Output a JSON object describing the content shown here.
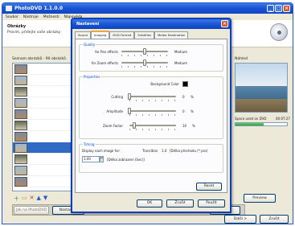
{
  "window": {
    "title": "PhotoDVD 1.1.0.0"
  },
  "menu": [
    "Soubor",
    "Nástroje",
    "Možnosti",
    "Nápověda"
  ],
  "header": {
    "title": "Obrázky",
    "subtitle": "Prosím, přidejte vaše obrázky"
  },
  "file_list": {
    "label": "Seznam obrázků - 90 obrázků",
    "rows": 11
  },
  "preview": {
    "label": "Náhled",
    "space_label": "Space used on DVD",
    "space_value": "00:07:27",
    "space_fraction": 0.55
  },
  "bottom_buttons": {
    "settings": "Nastavení",
    "back": "Zpět",
    "next": "Další >",
    "cancel": "Zrušit",
    "preview": "Preview",
    "left_hint": "Jak na PhotoDVD"
  },
  "dialog": {
    "title": "Nastavení",
    "tabs": [
      "Sound",
      "Imaging",
      "DVD Format",
      "Subtitles",
      "Media Destination"
    ],
    "active_tab": 1,
    "quality": {
      "label": "Quality",
      "pan_label": "for Pan effects",
      "pan_value": "Medium",
      "pan_level": 0.5,
      "zoom_label": "for Zoom effects",
      "zoom_value": "Medium",
      "zoom_level": 0.5
    },
    "properties": {
      "label": "Properties",
      "bg_label": "Background Color",
      "bg_color": "#000000",
      "cutting_label": "Cutting",
      "cutting_value": "0",
      "cutting_level": 0.0,
      "amplitude_label": "Amplitude",
      "amplitude_value": "0",
      "amplitude_level": 0.0,
      "zoom_factor_label": "Zoom Factor",
      "zoom_factor_value": "10",
      "zoom_factor_level": 0.1,
      "percent": "%"
    },
    "timing": {
      "label": "Timing",
      "display_label": "Display each image for:",
      "transition_label": "Transition",
      "transition_value": "1.0",
      "transition_suffix": "[Délka přechodu (* pro)",
      "duration_value": "3,00",
      "duration_hint": "[Délka zobrazení (Sec)]"
    },
    "reset": "Reset",
    "ok": "OK",
    "cancel": "Zrušit",
    "apply": "Použít"
  },
  "colors": {
    "accent": "#0c3fc0",
    "active_tab_border": "#f1a633",
    "face": "#ece9d8"
  }
}
